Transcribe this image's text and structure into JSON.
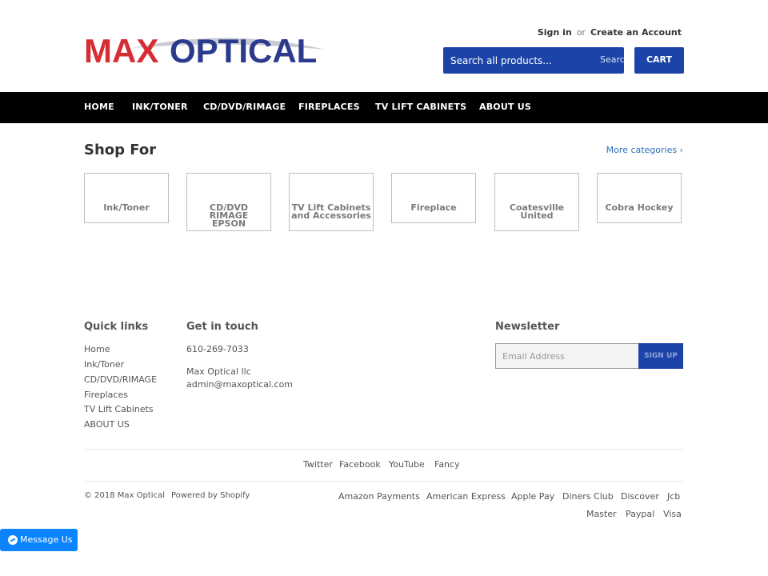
{
  "header": {
    "logo": {
      "part1": "MAX",
      "part2": "OPTICAL"
    },
    "sign_in": "Sign in",
    "or": "or",
    "create_account": "Create an Account",
    "search_placeholder": "Search all products...",
    "search_button": "Search",
    "cart": "CART"
  },
  "nav": [
    "HOME",
    "INK/TONER",
    "CD/DVD/RIMAGE",
    "FIREPLACES",
    "TV LIFT CABINETS",
    "ABOUT US"
  ],
  "shop": {
    "title": "Shop For",
    "more": "More categories ›",
    "tiles": [
      {
        "line1": "Ink/Toner",
        "line2": ""
      },
      {
        "line1": "CD/DVD RIMAGE",
        "line2": "EPSON"
      },
      {
        "line1": "TV Lift Cabinets",
        "line2": "and Accessories"
      },
      {
        "line1": "Fireplace",
        "line2": ""
      },
      {
        "line1": "Coatesville",
        "line2": "United"
      },
      {
        "line1": "Cobra Hockey",
        "line2": ""
      }
    ]
  },
  "footer": {
    "quick_links_title": "Quick links",
    "quick_links": [
      "Home",
      "Ink/Toner",
      "CD/DVD/RIMAGE",
      "Fireplaces",
      "TV Lift Cabinets",
      "ABOUT US"
    ],
    "touch_title": "Get in touch",
    "phone": "610-269-7033",
    "company": "Max Optical llc",
    "email": "admin@maxoptical.com",
    "newsletter_title": "Newsletter",
    "email_placeholder": "Email Address",
    "signup": "SIGN UP",
    "social": [
      "Twitter",
      "Facebook",
      "YouTube",
      "Fancy"
    ],
    "copyright": "© 2018 Max Optical",
    "powered": "Powered by Shopify",
    "payments": [
      "Amazon Payments",
      "American Express",
      "Apple Pay",
      "Diners Club",
      "Discover",
      "Jcb",
      "Master",
      "Paypal",
      "Visa"
    ]
  },
  "messenger": "Message Us",
  "colors": {
    "brand_blue": "#1c44a8",
    "logo_red": "#d62c34",
    "logo_navy": "#2b3a8c",
    "nav_bg": "#000000"
  }
}
